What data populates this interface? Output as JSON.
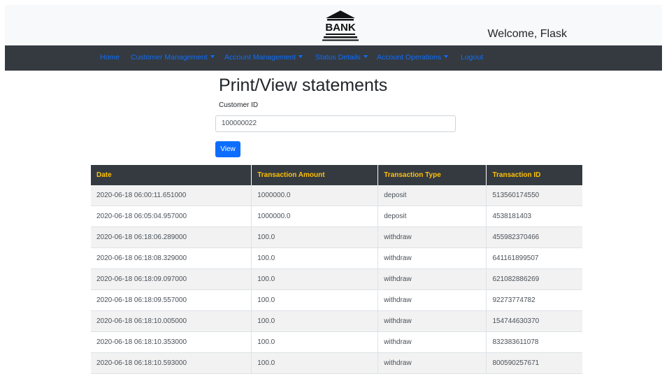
{
  "header": {
    "logo_text": "BANK",
    "welcome": "Welcome, Flask"
  },
  "nav": {
    "items": [
      {
        "label": "Home",
        "dropdown": false
      },
      {
        "label": "Customer Management",
        "dropdown": true
      },
      {
        "label": "Account Management",
        "dropdown": true
      },
      {
        "label": "Status Details",
        "dropdown": true
      },
      {
        "label": "Account Operations",
        "dropdown": true
      },
      {
        "label": "Logout",
        "dropdown": false
      }
    ]
  },
  "main": {
    "title": "Print/View statements",
    "customer_id_label": "Customer ID",
    "customer_id_value": "100000022",
    "view_label": "View"
  },
  "table": {
    "headers": [
      "Date",
      "Transaction Amount",
      "Transaction Type",
      "Transaction ID"
    ],
    "rows": [
      [
        "2020-06-18 06:00:11.651000",
        "1000000.0",
        "deposit",
        "513560174550"
      ],
      [
        "2020-06-18 06:05:04.957000",
        "1000000.0",
        "deposit",
        "4538181403"
      ],
      [
        "2020-06-18 06:18:06.289000",
        "100.0",
        "withdraw",
        "455982370466"
      ],
      [
        "2020-06-18 06:18:08.329000",
        "100.0",
        "withdraw",
        "641161899507"
      ],
      [
        "2020-06-18 06:18:09.097000",
        "100.0",
        "withdraw",
        "621082886269"
      ],
      [
        "2020-06-18 06:18:09.557000",
        "100.0",
        "withdraw",
        "92273774782"
      ],
      [
        "2020-06-18 06:18:10.005000",
        "100.0",
        "withdraw",
        "154744630370"
      ],
      [
        "2020-06-18 06:18:10.353000",
        "100.0",
        "withdraw",
        "832383611078"
      ],
      [
        "2020-06-18 06:18:10.593000",
        "100.0",
        "withdraw",
        "800590257671"
      ]
    ]
  },
  "colors": {
    "navbar_bg": "#343a40",
    "link": "#0d6efd",
    "table_header_text": "#ffc107",
    "button_bg": "#0d6efd"
  }
}
